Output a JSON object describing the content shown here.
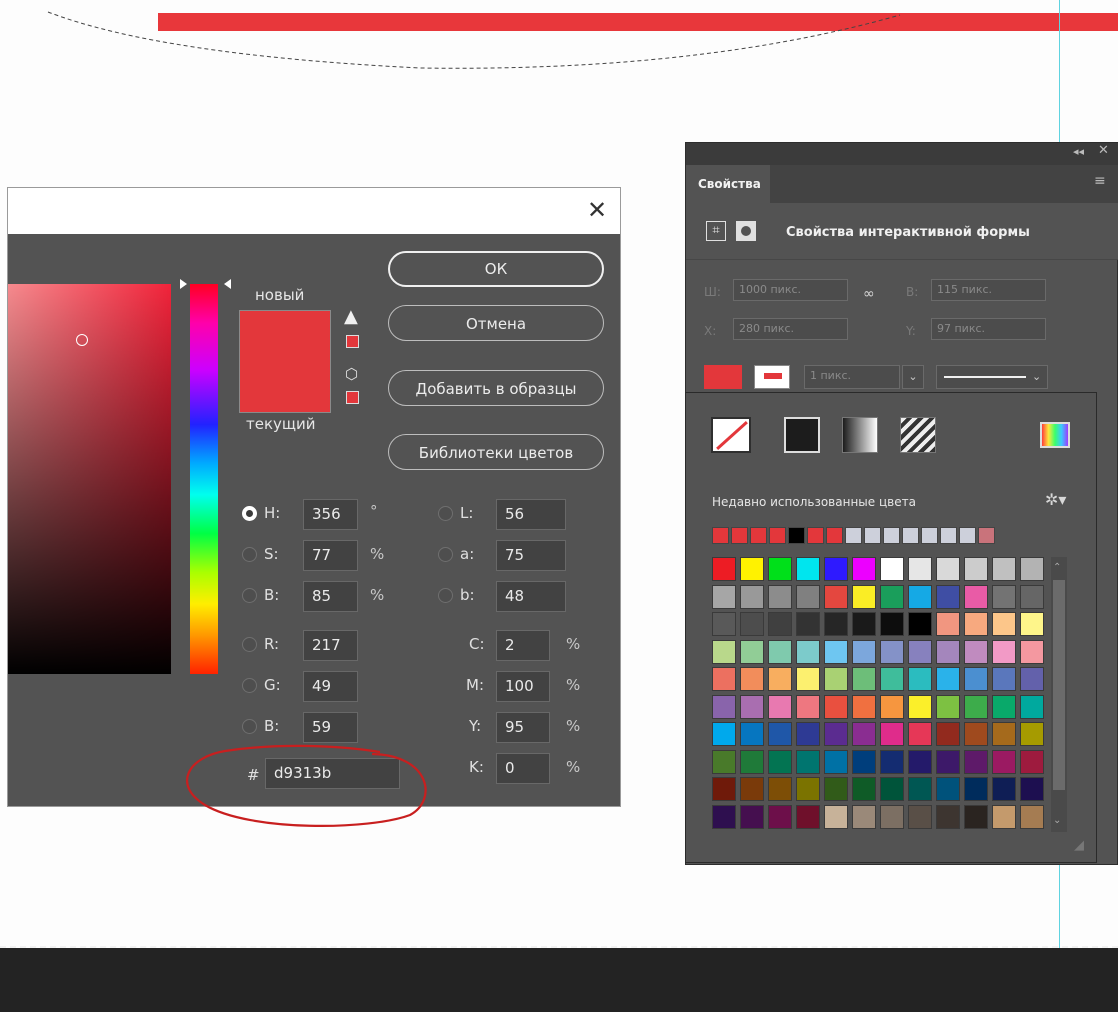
{
  "color_picker": {
    "close_glyph": "✕",
    "new_label": "новый",
    "current_label": "текущий",
    "new_color": "#e3373b",
    "buttons": {
      "ok": "ОК",
      "cancel": "Отмена",
      "add_to_swatches": "Добавить в образцы",
      "color_libraries": "Библиотеки цветов"
    },
    "fields": {
      "h": {
        "label": "H:",
        "value": "356",
        "unit": "°",
        "selected": true
      },
      "s": {
        "label": "S:",
        "value": "77",
        "unit": "%"
      },
      "b": {
        "label": "B:",
        "value": "85",
        "unit": "%"
      },
      "r": {
        "label": "R:",
        "value": "217"
      },
      "g": {
        "label": "G:",
        "value": "49"
      },
      "bl": {
        "label": "B:",
        "value": "59"
      },
      "l": {
        "label": "L:",
        "value": "56"
      },
      "a": {
        "label": "a:",
        "value": "75"
      },
      "lab_b": {
        "label": "b:",
        "value": "48"
      },
      "c": {
        "label": "C:",
        "value": "2",
        "unit": "%"
      },
      "m": {
        "label": "M:",
        "value": "100",
        "unit": "%"
      },
      "y": {
        "label": "Y:",
        "value": "95",
        "unit": "%"
      },
      "k": {
        "label": "K:",
        "value": "0",
        "unit": "%"
      },
      "hex": {
        "label": "#",
        "value": "d9313b"
      }
    }
  },
  "properties_panel": {
    "tab": "Свойства",
    "title": "Свойства интерактивной формы",
    "width_label": "Ш:",
    "width_value": "1000 пикс.",
    "height_label": "В:",
    "height_value": "115 пикс.",
    "x_label": "X:",
    "x_value": "280 пикс.",
    "y_label": "Y:",
    "y_value": "97 пикс.",
    "stroke_width": "1 пикс.",
    "fill_color": "#e3373b"
  },
  "swatch_popup": {
    "recent_label": "Недавно использованные цвета",
    "recent_colors": [
      "#e3373b",
      "#e3373b",
      "#e3373b",
      "#e3373b",
      "#000000",
      "#e3373b",
      "#e3373b",
      "#cdd0db",
      "#cdd0db",
      "#cdd0db",
      "#cdd0db",
      "#cdd0db",
      "#cdd0db",
      "#cdd0db",
      "#c9737b"
    ],
    "grid_colors": [
      [
        "#ed1c24",
        "#fff200",
        "#00e01a",
        "#00e5ee",
        "#2e1aff",
        "#ec00ff",
        "#ffffff",
        "#e6e6e6",
        "#d9d9d9",
        "#cccccc",
        "#c0c0c0",
        "#b3b3b3"
      ],
      [
        "#a6a6a6",
        "#999999",
        "#8c8c8c",
        "#808080",
        "#e4473f",
        "#faed25",
        "#1a9e5b",
        "#15a9e5",
        "#3f4ea4",
        "#e95ba6",
        "#737373",
        "#666666"
      ],
      [
        "#595959",
        "#4d4d4d",
        "#404040",
        "#333333",
        "#262626",
        "#1a1a1a",
        "#0d0d0d",
        "#000000",
        "#f19680",
        "#f7a97f",
        "#fcc68a",
        "#fef58a"
      ],
      [
        "#b9d88b",
        "#91cd96",
        "#7fcaad",
        "#7ccbcb",
        "#6ec6f1",
        "#7ca7dc",
        "#8492c8",
        "#8781be",
        "#a486bc",
        "#c08bbf",
        "#f29ac6",
        "#f498a0"
      ],
      [
        "#ec7060",
        "#f28d5b",
        "#f8ae5f",
        "#fcf06f",
        "#a9d173",
        "#6dbe79",
        "#3fbd9b",
        "#2bbcbf",
        "#2ab2ea",
        "#4b8fd0",
        "#5a77bc",
        "#6361ab"
      ],
      [
        "#8964ab",
        "#a96eb0",
        "#e879b0",
        "#ee7780",
        "#e9503f",
        "#f07040",
        "#f6963f",
        "#fbef2a",
        "#7dc142",
        "#3dac4b",
        "#09a96a",
        "#00a99e"
      ],
      [
        "#00a9ec",
        "#0676c0",
        "#1f57a8",
        "#2e3a94",
        "#5b2c90",
        "#8a2d91",
        "#df2c8b",
        "#e63757",
        "#922a1e",
        "#9f4a1e",
        "#a56a1c",
        "#a69b00"
      ],
      [
        "#497a2a",
        "#1f7a39",
        "#037452",
        "#00756f",
        "#0071a5",
        "#003e7c",
        "#142c71",
        "#241a6a",
        "#3d1969",
        "#5e1a69",
        "#9b1a62",
        "#9e1b3e"
      ],
      [
        "#6f1a0a",
        "#7a3a0a",
        "#7d4e06",
        "#7b7300",
        "#315b19",
        "#0f5b27",
        "#00543a",
        "#005753",
        "#00527b",
        "#002c5c",
        "#0f1e55",
        "#1d0f50"
      ],
      [
        "#2e0f4f",
        "#450f4f",
        "#6d0f4a",
        "#6f102b",
        "#c7b299",
        "#9a8979",
        "#7c6f63",
        "#594f47",
        "#3d3530",
        "#2a2420",
        "#c49a6c",
        "#a57c52"
      ]
    ]
  }
}
